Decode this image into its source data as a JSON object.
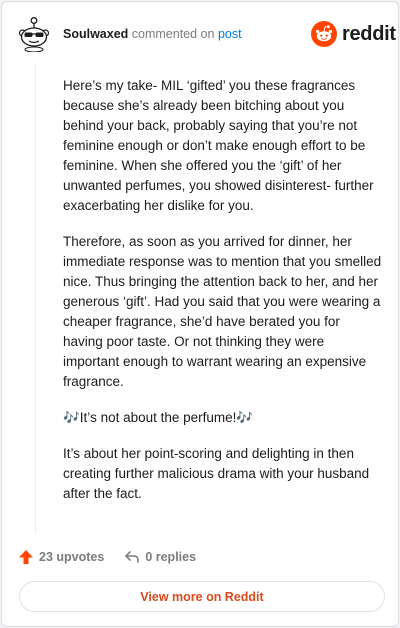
{
  "comment": {
    "username": "Soulwaxed",
    "action": "commented on",
    "post_link": "post",
    "paragraphs": [
      "Here’s my take- MIL ‘gifted’ you these fragrances because she’s already been bitching about you behind your back, probably saying that you’re not feminine enough or don’t make enough effort to be feminine. When she offered you the ‘gift’ of her unwanted perfumes, you showed disinterest- further exacerbating her dislike for you.",
      "Therefore, as soon as you arrived for dinner, her immediate response was to mention that you smelled nice. Thus bringing the attention back to her, and her generous ‘gift’. Had you said that you were wearing a cheaper fragrance, she’d have berated you for having poor taste. Or not thinking they were important enough to warrant wearing an expensive fragrance.",
      "🎶It’s not about the perfume!🎶",
      "It’s about her point-scoring and delighting in then creating further malicious drama with your husband after the fact."
    ]
  },
  "brand": {
    "wordmark": "reddit",
    "color": "#ff4500"
  },
  "actions": {
    "upvotes": "23 upvotes",
    "replies": "0 replies"
  },
  "footer": {
    "view_more": "View more on Reddit",
    "accent": "#d94a1c"
  }
}
